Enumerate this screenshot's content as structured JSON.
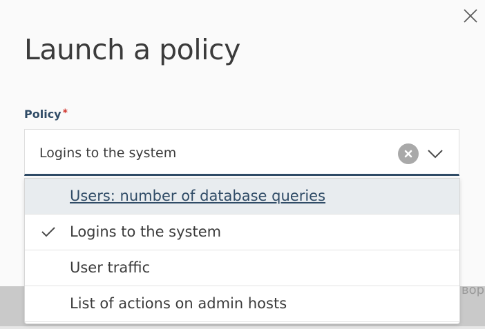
{
  "modal": {
    "title": "Launch a policy",
    "close_icon": "close-icon"
  },
  "policy_field": {
    "label": "Policy",
    "required_marker": "*",
    "selected_value": "Logins to the system",
    "clear_icon": "clear-icon",
    "chevron_icon": "chevron-down-icon"
  },
  "dropdown": {
    "options": [
      {
        "label": "Users: number of database queries",
        "highlighted": true,
        "selected": false
      },
      {
        "label": "Logins to the system",
        "highlighted": false,
        "selected": true
      },
      {
        "label": "User traffic",
        "highlighted": false,
        "selected": false
      },
      {
        "label": "List of actions on admin hosts",
        "highlighted": false,
        "selected": false
      }
    ]
  },
  "background": {
    "partial_text": "вор"
  },
  "colors": {
    "accent": "#2f4b66",
    "required": "#d0342c",
    "highlight_bg": "#e8ecef",
    "text": "#3b3b3b"
  }
}
